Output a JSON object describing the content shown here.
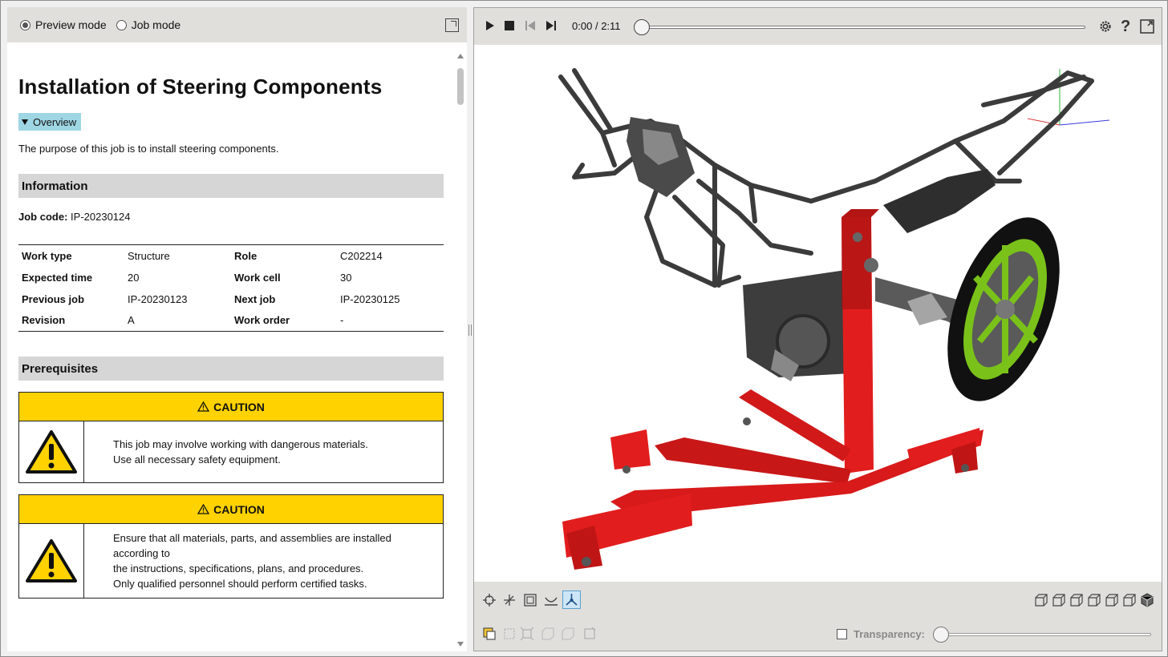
{
  "mode_bar": {
    "preview_label": "Preview mode",
    "job_label": "Job mode",
    "selected": "preview"
  },
  "doc": {
    "title": "Installation of Steering Components",
    "overview_label": "Overview",
    "purpose": "The purpose of this job is to install steering components.",
    "information_heading": "Information",
    "job_code_label": "Job code:",
    "job_code_value": "IP-20230124",
    "info_rows": [
      {
        "k1": "Work type",
        "v1": "Structure",
        "k2": "Role",
        "v2": "C202214"
      },
      {
        "k1": "Expected time",
        "v1": "20",
        "k2": "Work cell",
        "v2": "30"
      },
      {
        "k1": "Previous job",
        "v1": "IP-20230123",
        "k2": "Next job",
        "v2": "IP-20230125"
      },
      {
        "k1": "Revision",
        "v1": "A",
        "k2": "Work order",
        "v2": "-"
      }
    ],
    "prerequisites_heading": "Prerequisites",
    "cautions": [
      {
        "title": "CAUTION",
        "lines": [
          "This job may involve working with dangerous materials.",
          "Use all necessary safety equipment."
        ]
      },
      {
        "title": "CAUTION",
        "lines": [
          "Ensure that all materials, parts, and assemblies are installed",
          "according to",
          "the instructions, specifications, plans, and procedures.",
          "Only qualified personnel should perform certified tasks."
        ]
      }
    ]
  },
  "player": {
    "current_time": "0:00",
    "separator": "/",
    "total_time": "2:11",
    "progress": 0
  },
  "viewer": {
    "transparency_label": "Transparency:",
    "transparency_checked": false,
    "transparency_value": 0
  },
  "colors": {
    "caution_header": "#ffd200",
    "overview_tag": "#9fd6e4",
    "stand_red": "#e21d1d",
    "wheel_green": "#7ac21a"
  },
  "icons": [
    "play-icon",
    "stop-icon",
    "skip-back-icon",
    "skip-forward-icon",
    "settings-icon",
    "help-icon",
    "fullscreen-icon",
    "warning-triangle-icon"
  ]
}
